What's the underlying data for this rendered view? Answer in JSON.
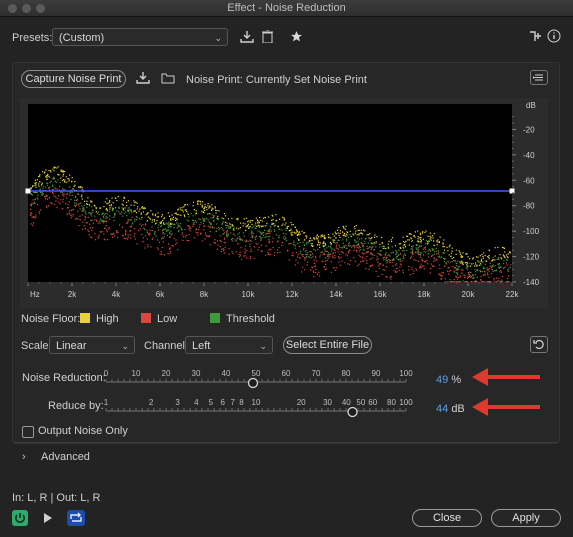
{
  "window": {
    "title": "Effect - Noise Reduction"
  },
  "presets": {
    "label": "Presets:",
    "value": "(Custom)"
  },
  "capture": {
    "button_label": "Capture Noise Print",
    "noise_print_label": "Noise Print:",
    "noise_print_value": "Currently Set Noise Print"
  },
  "graph": {
    "y_unit": "dB",
    "y_ticks": [
      "-20",
      "-40",
      "-60",
      "-80",
      "-100",
      "-120",
      "-140"
    ],
    "x_ticks": [
      "Hz",
      "2k",
      "4k",
      "6k",
      "8k",
      "10k",
      "12k",
      "14k",
      "16k",
      "18k",
      "20k",
      "22k"
    ]
  },
  "legend": {
    "label": "Noise Floor:",
    "items": [
      {
        "name": "High",
        "color": "#e8d23a"
      },
      {
        "name": "Low",
        "color": "#d9473f"
      },
      {
        "name": "Threshold",
        "color": "#3f9a3a"
      }
    ]
  },
  "controls": {
    "scale_label": "Scale:",
    "scale_value": "Linear",
    "channel_label": "Channel:",
    "channel_value": "Left",
    "select_entire_file": "Select Entire File"
  },
  "noise_reduction": {
    "label": "Noise Reduction:",
    "ticks": [
      "0",
      "10",
      "20",
      "30",
      "40",
      "50",
      "60",
      "70",
      "80",
      "90",
      "100"
    ],
    "value": "49",
    "unit": "%"
  },
  "reduce_by": {
    "label": "Reduce by:",
    "ticks": [
      "1",
      "2",
      "3",
      "4",
      "5",
      "6",
      "7",
      "8",
      "10",
      "20",
      "30",
      "40",
      "50",
      "60",
      "80",
      "100"
    ],
    "value": "44",
    "unit": "dB"
  },
  "output_noise_only": {
    "label": "Output Noise Only",
    "checked": false
  },
  "advanced": {
    "label": "Advanced"
  },
  "io": {
    "text": "In: L, R | Out: L, R"
  },
  "buttons": {
    "close": "Close",
    "apply": "Apply"
  },
  "colors": {
    "high": "#e8d23a",
    "low": "#d9473f",
    "threshold": "#3f9a3a",
    "curve": "#3a5cff",
    "value_blue": "#5aa0e6",
    "arrow": "#e03a2f",
    "power": "#2faa6b"
  }
}
